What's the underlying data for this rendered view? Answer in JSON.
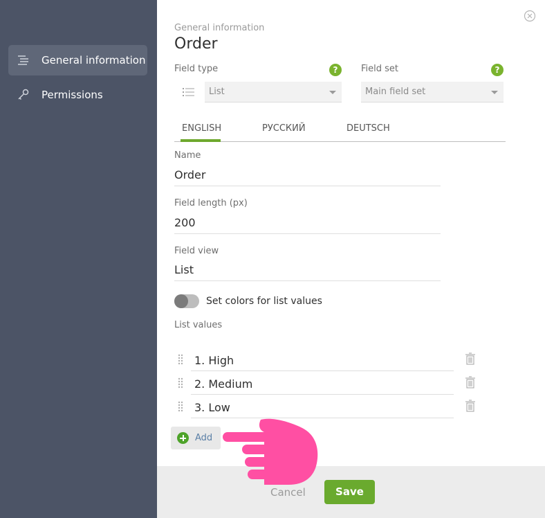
{
  "sidebar": {
    "items": [
      {
        "label": "General information",
        "icon": "list-lines-icon",
        "active": true
      },
      {
        "label": "Permissions",
        "icon": "key-icon",
        "active": false
      }
    ]
  },
  "header": {
    "subtitle": "General information",
    "title": "Order"
  },
  "field_type": {
    "label": "Field type",
    "value": "List",
    "help": "?"
  },
  "field_set": {
    "label": "Field set",
    "value": "Main field set",
    "help": "?"
  },
  "tabs": [
    {
      "label": "ENGLISH",
      "active": true
    },
    {
      "label": "РУССКИЙ",
      "active": false
    },
    {
      "label": "DEUTSCH",
      "active": false
    }
  ],
  "name": {
    "label": "Name",
    "value": "Order"
  },
  "field_length": {
    "label": "Field length (px)",
    "value": "200"
  },
  "field_view": {
    "label": "Field view",
    "value": "List"
  },
  "colors_toggle": {
    "label": "Set colors for list values",
    "on": false
  },
  "list_values": {
    "label": "List values",
    "items": [
      "1. High",
      "2. Medium",
      "3. Low"
    ],
    "add_label": "Add"
  },
  "footer": {
    "cancel_label": "Cancel",
    "save_label": "Save"
  },
  "colors": {
    "accent": "#6aaa2e",
    "sidebar": "#4c5466",
    "pointer": "#ff4fa3"
  }
}
